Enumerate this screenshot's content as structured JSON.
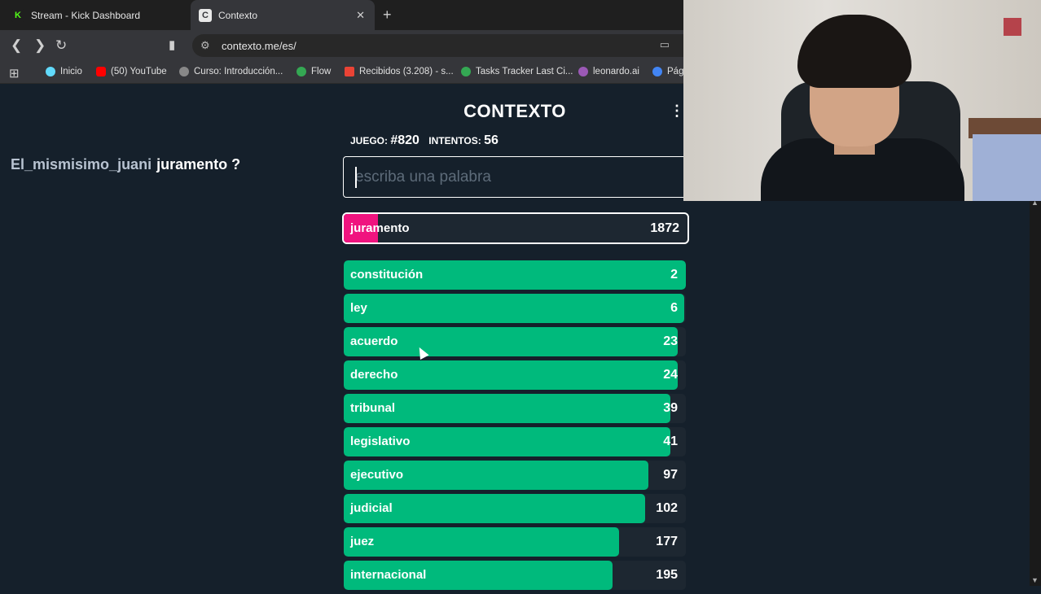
{
  "browser": {
    "tabs": [
      {
        "label": "Stream - Kick Dashboard",
        "icon": "kick-icon"
      },
      {
        "label": "Contexto",
        "icon": "contexto-icon"
      }
    ],
    "url": "contexto.me/es/",
    "bookmarks": [
      {
        "label": "Inicio",
        "color": "#61dafb"
      },
      {
        "label": "(50) YouTube",
        "color": "#ff0000"
      },
      {
        "label": "Curso: Introducción...",
        "color": "#888888"
      },
      {
        "label": "Flow",
        "color": "#34a853"
      },
      {
        "label": "Recibidos (3.208) - s...",
        "color": "#ea4335"
      },
      {
        "label": "Tasks Tracker Last Ci...",
        "color": "#34a853"
      },
      {
        "label": "leonardo.ai",
        "color": "#9b59b6"
      },
      {
        "label": "Pág",
        "color": "#4285f4"
      }
    ]
  },
  "chat": {
    "user": "El_mismisimo_juani",
    "message": "juramento ?"
  },
  "game": {
    "title": "CONTEXTO",
    "menu_icon": "⋮",
    "juego_label": "JUEGO:",
    "juego_value": "#820",
    "intentos_label": "INTENTOS:",
    "intentos_value": "56",
    "input_placeholder": "escriba una palabra",
    "current": {
      "word": "juramento",
      "rank": 1872,
      "fill": 0.1
    },
    "guesses": [
      {
        "word": "constitución",
        "rank": 2,
        "fill": 1.0
      },
      {
        "word": "ley",
        "rank": 6,
        "fill": 0.995
      },
      {
        "word": "acuerdo",
        "rank": 23,
        "fill": 0.975
      },
      {
        "word": "derecho",
        "rank": 24,
        "fill": 0.975
      },
      {
        "word": "tribunal",
        "rank": 39,
        "fill": 0.955
      },
      {
        "word": "legislativo",
        "rank": 41,
        "fill": 0.955
      },
      {
        "word": "ejecutivo",
        "rank": 97,
        "fill": 0.89
      },
      {
        "word": "judicial",
        "rank": 102,
        "fill": 0.88
      },
      {
        "word": "juez",
        "rank": 177,
        "fill": 0.805
      },
      {
        "word": "internacional",
        "rank": 195,
        "fill": 0.785
      }
    ]
  },
  "colors": {
    "background": "#15202b",
    "guess_fill": "#00ba7c",
    "current_fill": "#f0137f"
  }
}
